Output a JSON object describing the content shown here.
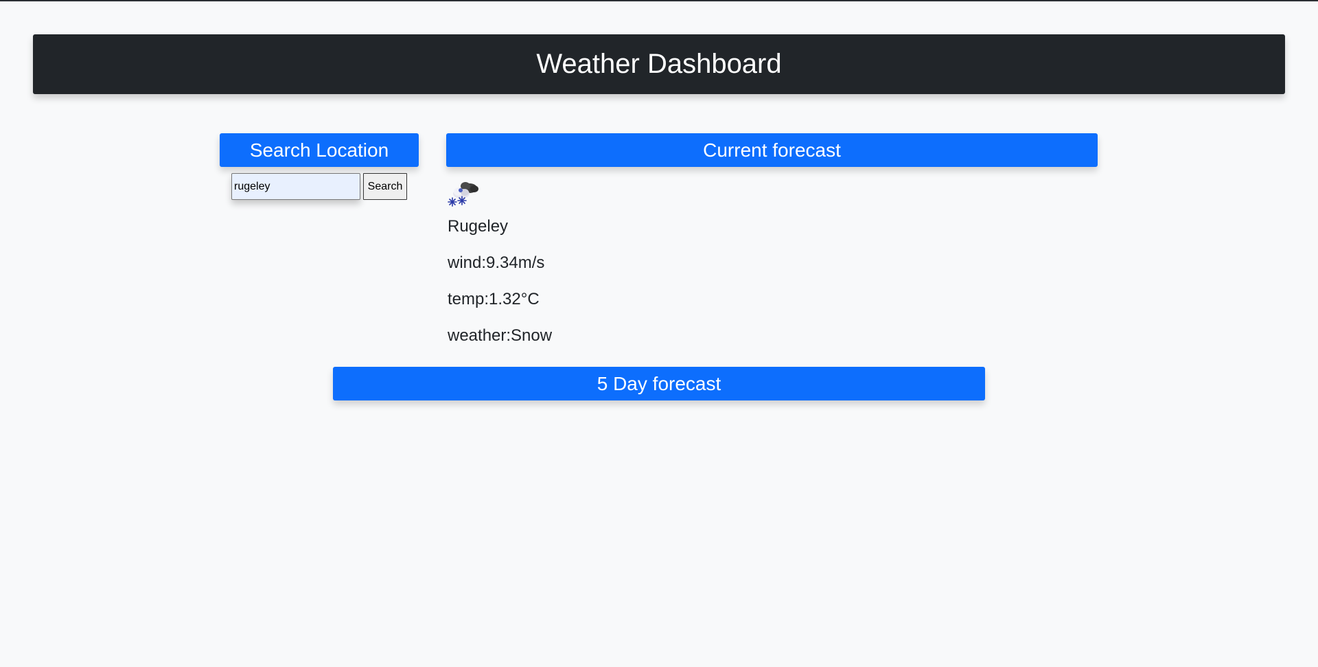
{
  "app": {
    "title": "Weather Dashboard"
  },
  "search": {
    "heading": "Search Location",
    "input_value": "rugeley",
    "button_label": "Search"
  },
  "current": {
    "heading": "Current forecast",
    "icon": "snow-cloud-icon",
    "city": "Rugeley",
    "wind_text": "wind:9.34m/s",
    "temp_text": "temp:1.32°C",
    "weather_text": "weather:Snow"
  },
  "five_day": {
    "heading": "5 Day forecast"
  },
  "colors": {
    "header_bg": "#212529",
    "accent": "#0d6efd",
    "page_bg": "#f8f9fa"
  }
}
